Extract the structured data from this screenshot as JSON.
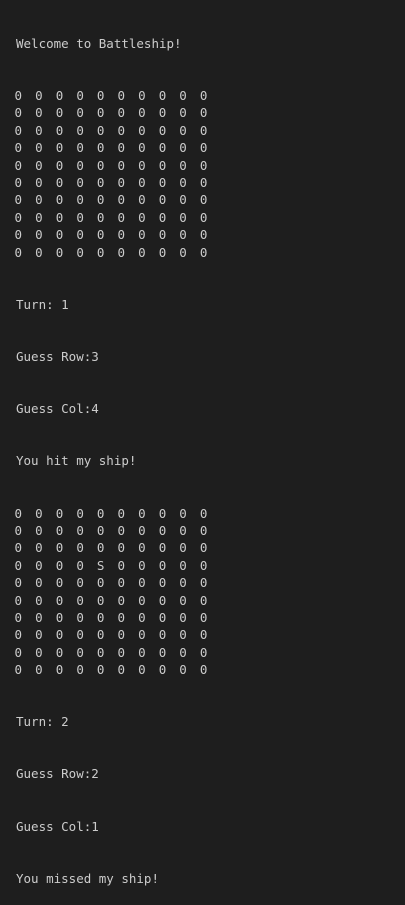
{
  "terminal": {
    "welcome": "Welcome to Battleship!",
    "board1": [
      [
        "0",
        "0",
        "0",
        "0",
        "0",
        "0",
        "0",
        "0",
        "0",
        "0"
      ],
      [
        "0",
        "0",
        "0",
        "0",
        "0",
        "0",
        "0",
        "0",
        "0",
        "0"
      ],
      [
        "0",
        "0",
        "0",
        "0",
        "0",
        "0",
        "0",
        "0",
        "0",
        "0"
      ],
      [
        "0",
        "0",
        "0",
        "0",
        "0",
        "0",
        "0",
        "0",
        "0",
        "0"
      ],
      [
        "0",
        "0",
        "0",
        "0",
        "0",
        "0",
        "0",
        "0",
        "0",
        "0"
      ],
      [
        "0",
        "0",
        "0",
        "0",
        "0",
        "0",
        "0",
        "0",
        "0",
        "0"
      ],
      [
        "0",
        "0",
        "0",
        "0",
        "0",
        "0",
        "0",
        "0",
        "0",
        "0"
      ],
      [
        "0",
        "0",
        "0",
        "0",
        "0",
        "0",
        "0",
        "0",
        "0",
        "0"
      ],
      [
        "0",
        "0",
        "0",
        "0",
        "0",
        "0",
        "0",
        "0",
        "0",
        "0"
      ],
      [
        "0",
        "0",
        "0",
        "0",
        "0",
        "0",
        "0",
        "0",
        "0",
        "0"
      ]
    ],
    "turn1": "Turn: 1",
    "guess_row1": "Guess Row:3",
    "guess_col1": "Guess Col:4",
    "result1": "You hit my ship!",
    "board2": [
      [
        "0",
        "0",
        "0",
        "0",
        "0",
        "0",
        "0",
        "0",
        "0",
        "0"
      ],
      [
        "0",
        "0",
        "0",
        "0",
        "0",
        "0",
        "0",
        "0",
        "0",
        "0"
      ],
      [
        "0",
        "0",
        "0",
        "0",
        "0",
        "0",
        "0",
        "0",
        "0",
        "0"
      ],
      [
        "0",
        "0",
        "0",
        "0",
        "S",
        "0",
        "0",
        "0",
        "0",
        "0"
      ],
      [
        "0",
        "0",
        "0",
        "0",
        "0",
        "0",
        "0",
        "0",
        "0",
        "0"
      ],
      [
        "0",
        "0",
        "0",
        "0",
        "0",
        "0",
        "0",
        "0",
        "0",
        "0"
      ],
      [
        "0",
        "0",
        "0",
        "0",
        "0",
        "0",
        "0",
        "0",
        "0",
        "0"
      ],
      [
        "0",
        "0",
        "0",
        "0",
        "0",
        "0",
        "0",
        "0",
        "0",
        "0"
      ],
      [
        "0",
        "0",
        "0",
        "0",
        "0",
        "0",
        "0",
        "0",
        "0",
        "0"
      ],
      [
        "0",
        "0",
        "0",
        "0",
        "0",
        "0",
        "0",
        "0",
        "0",
        "0"
      ]
    ],
    "turn2": "Turn: 2",
    "guess_row2": "Guess Row:2",
    "guess_col2": "Guess Col:1",
    "result2": "You missed my ship!"
  },
  "colors": {
    "background": "#1e1e1e",
    "text": "#cccccc"
  }
}
